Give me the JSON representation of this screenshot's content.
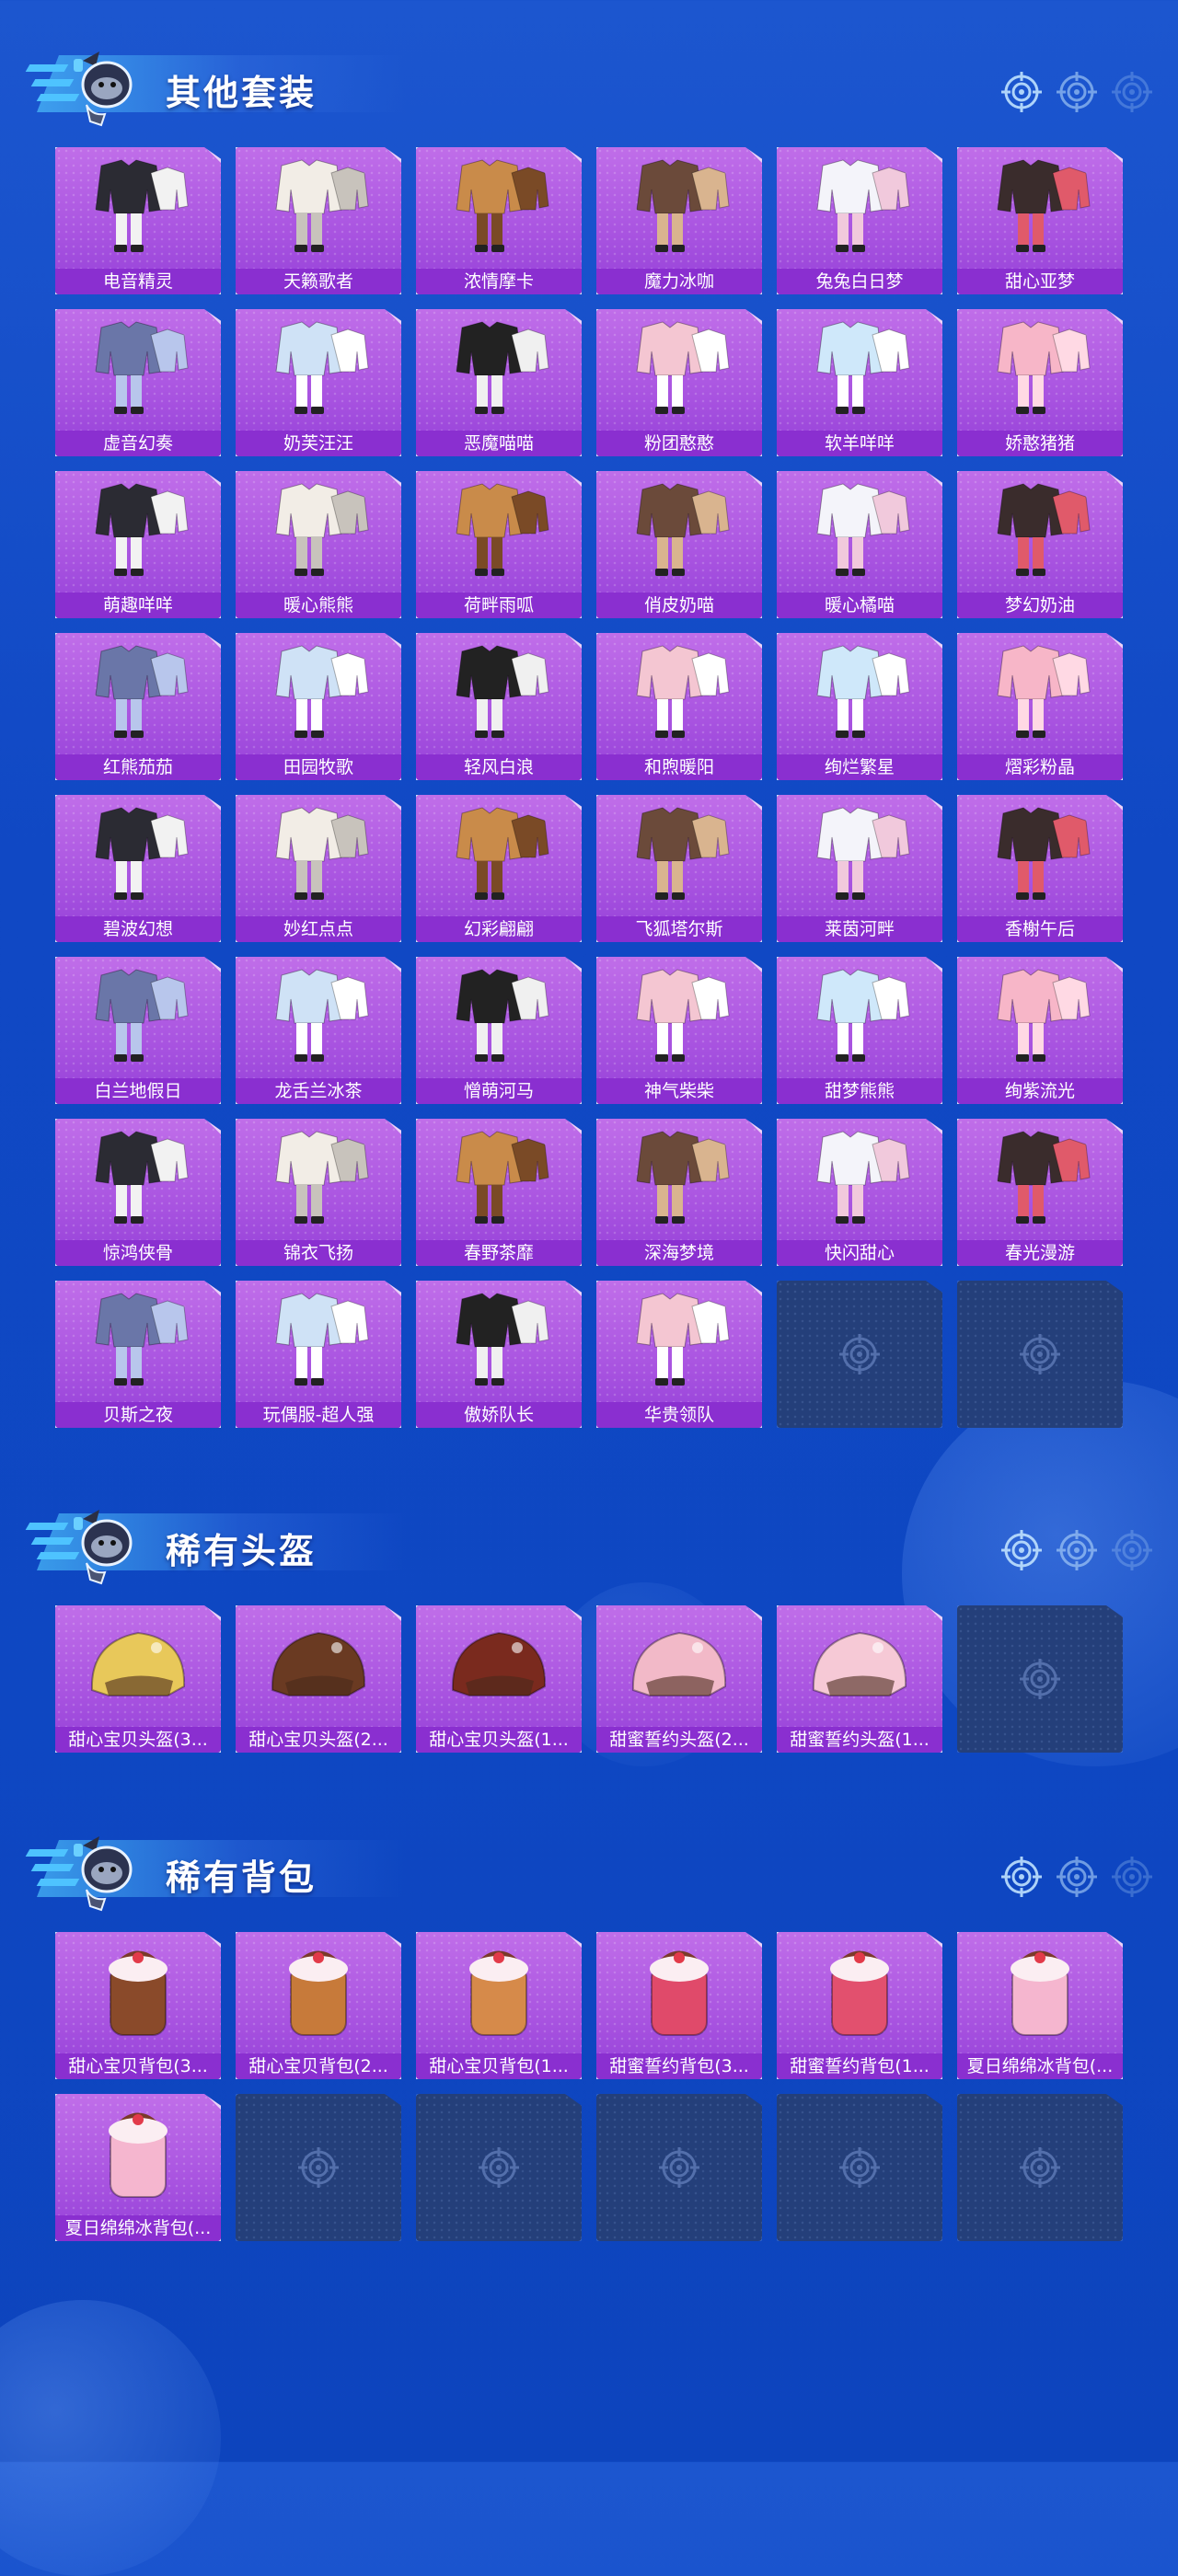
{
  "sections": [
    {
      "title": "其他套装",
      "kind": "outfit",
      "items": [
        "电音精灵",
        "天籁歌者",
        "浓情摩卡",
        "魔力冰咖",
        "兔兔白日梦",
        "甜心亚梦",
        "虚音幻奏",
        "奶芙汪汪",
        "恶魔喵喵",
        "粉团憨憨",
        "软羊咩咩",
        "娇憨猪猪",
        "萌趣咩咩",
        "暖心熊熊",
        "荷畔雨呱",
        "俏皮奶喵",
        "暖心橘喵",
        "梦幻奶油",
        "红熊茄茄",
        "田园牧歌",
        "轻风白浪",
        "和煦暖阳",
        "绚烂繁星",
        "熠彩粉晶",
        "碧波幻想",
        "妙红点点",
        "幻彩翩翩",
        "飞狐塔尔斯",
        "莱茵河畔",
        "香榭午后",
        "白兰地假日",
        "龙舌兰冰茶",
        "憎萌河马",
        "神气柴柴",
        "甜梦熊熊",
        "绚紫流光",
        "惊鸿侠骨",
        "锦衣飞扬",
        "春野茶靡",
        "深海梦境",
        "快闪甜心",
        "春光漫游",
        "贝斯之夜",
        "玩偶服-超人强",
        "傲娇队长",
        "华贵领队"
      ],
      "empty_slots": 2
    },
    {
      "title": "稀有头盔",
      "kind": "helmet",
      "items": [
        "甜心宝贝头盔(3...",
        "甜心宝贝头盔(2...",
        "甜心宝贝头盔(1...",
        "甜蜜誓约头盔(2...",
        "甜蜜誓约头盔(1..."
      ],
      "empty_slots": 1
    },
    {
      "title": "稀有背包",
      "kind": "backpack",
      "items": [
        "甜心宝贝背包(3...",
        "甜心宝贝背包(2...",
        "甜心宝贝背包(1...",
        "甜蜜誓约背包(3...",
        "甜蜜誓约背包(1...",
        "夏日绵绵冰背包(...",
        "夏日绵绵冰背包(..."
      ],
      "empty_slots": 5
    }
  ],
  "colors": {
    "background": "#1048c4",
    "card": "#a853e0",
    "label_bar": "#8a2fd0",
    "empty_slot": "#243f7a",
    "accent": "#4ec3ff"
  },
  "icons": [
    "crosshair-icon",
    "mascot-icon"
  ]
}
